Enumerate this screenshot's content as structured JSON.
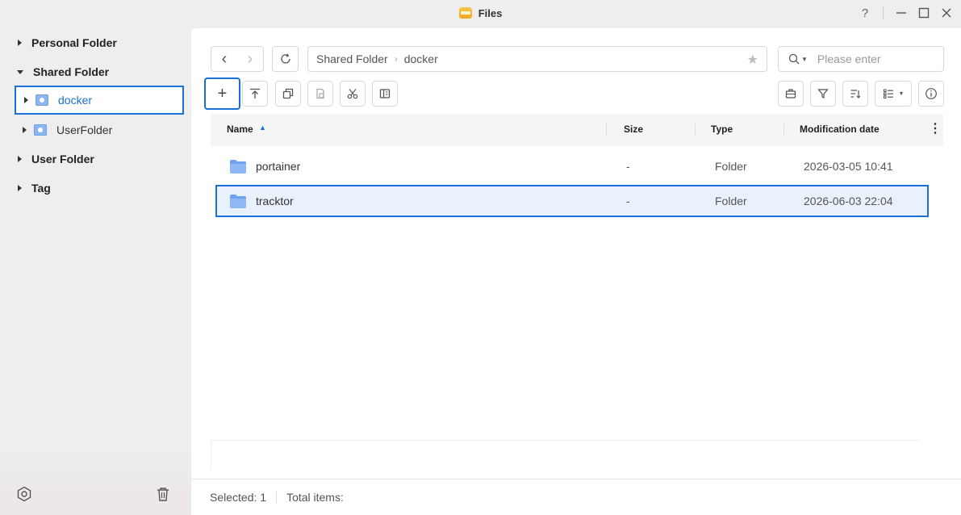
{
  "window": {
    "title": "Files",
    "help": "?",
    "minimize": "—",
    "maximize": "☐",
    "close": "✕"
  },
  "sidebar": {
    "personal_folder": "Personal Folder",
    "shared_folder": "Shared Folder",
    "shared_children": [
      {
        "label": "docker"
      },
      {
        "label": "UserFolder"
      }
    ],
    "user_folder": "User Folder",
    "tag": "Tag"
  },
  "nav": {
    "back": "‹",
    "forward": "›"
  },
  "breadcrumb": [
    "Shared Folder",
    "docker"
  ],
  "search": {
    "placeholder": "Please enter",
    "value": ""
  },
  "toolbar": {
    "new": "+"
  },
  "table": {
    "columns": [
      "Name",
      "Size",
      "Type",
      "Modification date"
    ],
    "rows": [
      {
        "name": "portainer",
        "size": "-",
        "type": "Folder",
        "modified": "2026-03-05 10:41"
      },
      {
        "name": "tracktor",
        "size": "-",
        "type": "Folder",
        "modified": "2026-06-03 22:04"
      }
    ]
  },
  "status": {
    "selected": "Selected: 1",
    "total": "Total items:"
  },
  "colors": {
    "accent": "#1a6fd9",
    "folder": "#6fa3f0",
    "selected_row": "#e9f1fd"
  }
}
